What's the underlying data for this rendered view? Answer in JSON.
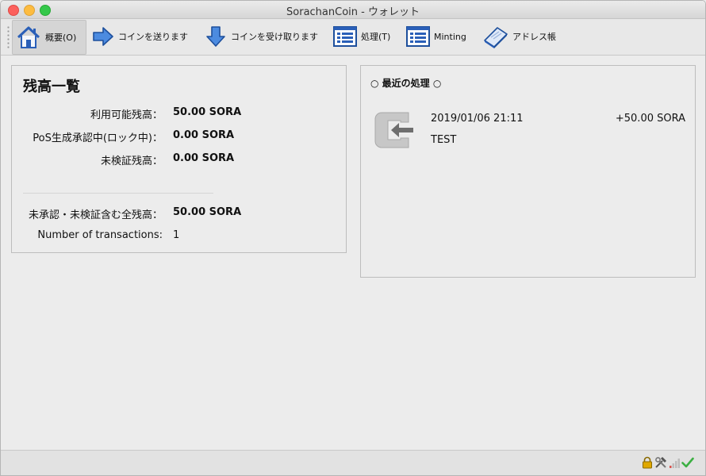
{
  "window": {
    "title": "SorachanCoin - ウォレット"
  },
  "toolbar": {
    "items": [
      {
        "label": "概要(O)",
        "icon": "home-icon"
      },
      {
        "label": "コインを送ります",
        "icon": "arrow-right-icon"
      },
      {
        "label": "コインを受け取ります",
        "icon": "arrow-down-icon"
      },
      {
        "label": "処理(T)",
        "icon": "list-icon"
      },
      {
        "label": "Minting",
        "icon": "list-icon"
      },
      {
        "label": "アドレス帳",
        "icon": "book-icon"
      }
    ]
  },
  "balance": {
    "heading": "残高一覧",
    "available_label": "利用可能残高：",
    "available_value": "50.00 SORA",
    "pos_label": "PoS生成承認中(ロック中)：",
    "pos_value": "0.00 SORA",
    "unconfirmed_label": "未検証残高：",
    "unconfirmed_value": "0.00 SORA",
    "total_label": "未承認・未検証含む全残高：",
    "total_value": "50.00 SORA",
    "tx_count_label": "Number of transactions:",
    "tx_count_value": "1"
  },
  "recent": {
    "heading": "○ 最近の処理 ○",
    "transactions": [
      {
        "datetime": "2019/01/06 21:11",
        "amount": "+50.00 SORA",
        "label": "TEST",
        "icon": "receive-icon"
      }
    ]
  },
  "status": {
    "icons": [
      "lock-icon",
      "tools-icon",
      "signal-icon",
      "check-icon"
    ],
    "colors": {
      "lock": "#e0a800",
      "check": "#3cb043"
    }
  }
}
